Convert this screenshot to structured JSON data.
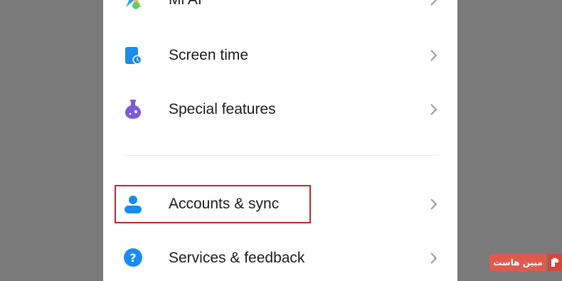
{
  "settings": {
    "items": [
      {
        "label": "Mi AI",
        "icon": "mi-ai-icon"
      },
      {
        "label": "Screen time",
        "icon": "screen-time-icon"
      },
      {
        "label": "Special features",
        "icon": "special-features-icon"
      },
      {
        "label": "Accounts & sync",
        "icon": "account-icon",
        "highlighted": true
      },
      {
        "label": "Services & feedback",
        "icon": "help-icon"
      }
    ]
  },
  "watermark": {
    "text": "مبین هاست",
    "color": "#e05a4c"
  },
  "colors": {
    "highlight_border": "#c0262d",
    "accent_blue": "#1a8cf0",
    "accent_purple": "#7d5bd8"
  }
}
